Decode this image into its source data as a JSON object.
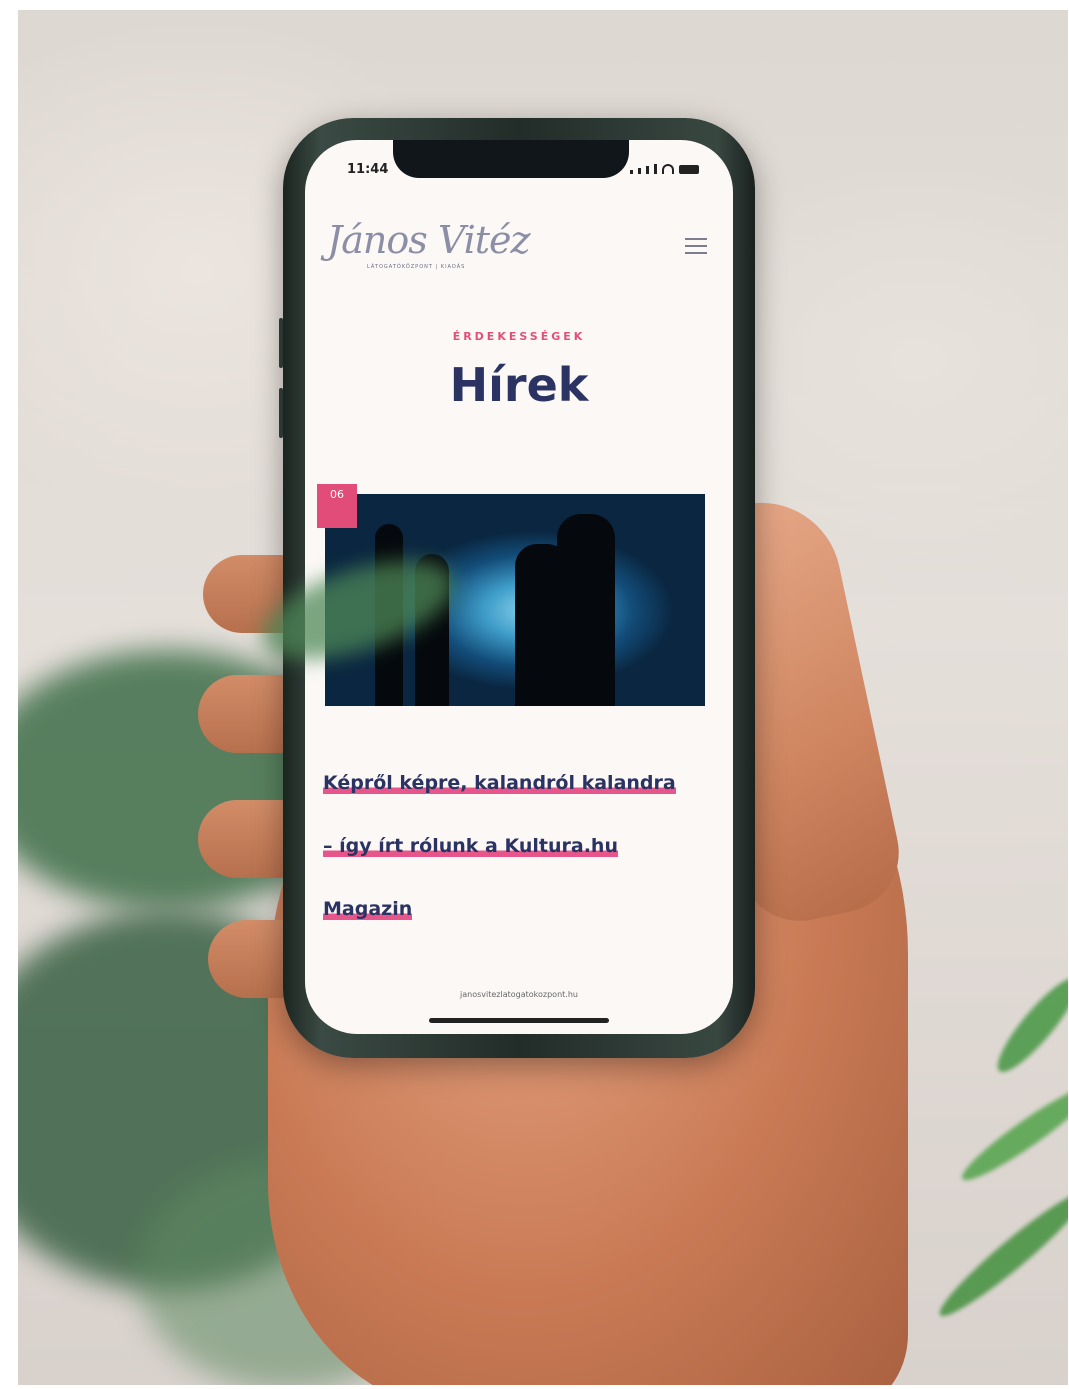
{
  "status_bar": {
    "time": "11:44"
  },
  "header": {
    "logo_text": "János Vitéz",
    "logo_subtitle": "LÁTOGATÓKÖZPONT | KIADÁS",
    "menu_icon": "hamburger-menu-icon"
  },
  "page": {
    "kicker": "ÉRDEKESSÉGEK",
    "title": "Hírek"
  },
  "article": {
    "date_day": "06",
    "headline_lines": [
      "Képről képre, kalandról kalandra",
      "– így írt rólunk a Kultura.hu",
      "Magazin"
    ]
  },
  "browser": {
    "url": "janosvitezlatogatokozpont.hu"
  },
  "colors": {
    "accent": "#e24c78",
    "title": "#2b3363"
  }
}
